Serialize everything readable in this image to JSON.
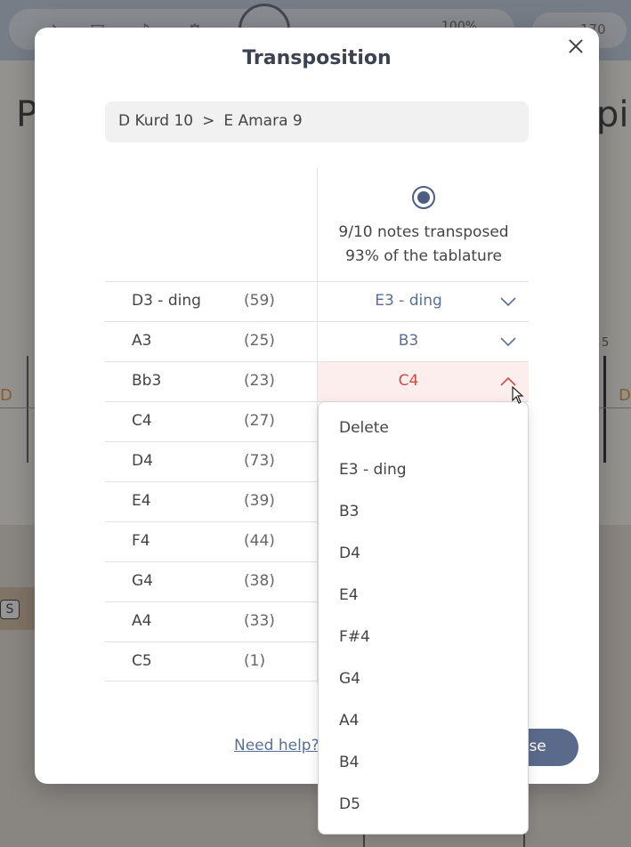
{
  "background": {
    "zoom_text": "100%",
    "tempo_text": "170",
    "title_left_fragment": "P",
    "title_right_fragment": "pi",
    "staff_note_left": "D",
    "staff_note_right": "D",
    "staff_measure_number": "5",
    "key_hint": "S"
  },
  "modal": {
    "title": "Transposition",
    "breadcrumb": {
      "from": "D Kurd 10",
      "separator": ">",
      "to": "E Amara 9"
    },
    "option": {
      "selected": true,
      "notes_transposed": "9/10 notes transposed",
      "tablature_percent": "93% of the tablature"
    },
    "rows": [
      {
        "note": "D3 - ding",
        "count": "(59)",
        "target": "E3 - ding",
        "chevron": "chevron-down"
      },
      {
        "note": "A3",
        "count": "(25)",
        "target": "B3",
        "chevron": "chevron-down"
      },
      {
        "note": "Bb3",
        "count": "(23)",
        "target": "C4",
        "chevron": "chevron-up"
      },
      {
        "note": "C4",
        "count": "(27)",
        "target": ""
      },
      {
        "note": "D4",
        "count": "(73)",
        "target": ""
      },
      {
        "note": "E4",
        "count": "(39)",
        "target": ""
      },
      {
        "note": "F4",
        "count": "(44)",
        "target": ""
      },
      {
        "note": "G4",
        "count": "(38)",
        "target": ""
      },
      {
        "note": "A4",
        "count": "(33)",
        "target": ""
      },
      {
        "note": "C5",
        "count": "(1)",
        "target": ""
      }
    ],
    "help_link": "Need help?",
    "choose_button": "Choose",
    "choose_button_visible": "ose"
  },
  "dropdown": {
    "items": [
      "Delete",
      "E3 - ding",
      "B3",
      "D4",
      "E4",
      "F#4",
      "G4",
      "A4",
      "B4",
      "D5"
    ]
  },
  "colors": {
    "accent": "#5a6f96",
    "active_text": "#cf4a43",
    "active_bg": "#fdeeee",
    "button_bg": "#5a6a8a"
  }
}
